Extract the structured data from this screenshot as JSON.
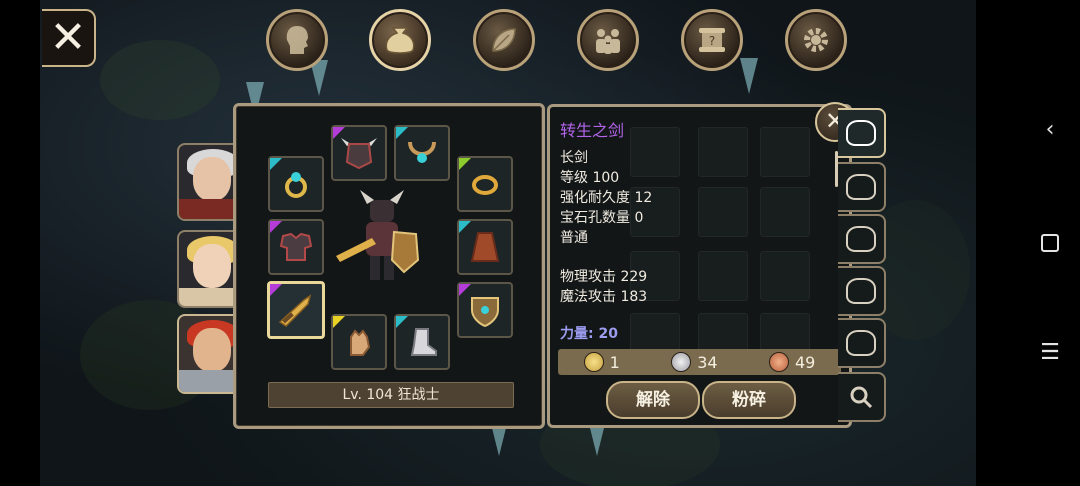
{
  "top_tabs": [
    {
      "name": "character",
      "icon": "head-silhouette-icon"
    },
    {
      "name": "inventory",
      "icon": "bag-icon",
      "active": true
    },
    {
      "name": "skills",
      "icon": "leaf-icon"
    },
    {
      "name": "party",
      "icon": "group-icon"
    },
    {
      "name": "quests",
      "icon": "scroll-icon"
    },
    {
      "name": "settings",
      "icon": "gear-icon"
    }
  ],
  "character": {
    "level_text": "Lv. 104 狂战士"
  },
  "item": {
    "name": "转生之剑",
    "type": "长剑",
    "level": "等级 100",
    "durability": "强化耐久度 12",
    "sockets": "宝石孔数量 0",
    "rarity": "普通",
    "phys_attack": "物理攻击 229",
    "mag_attack": "魔法攻击 183",
    "strength": "力量: 20"
  },
  "currency": {
    "gold": "1",
    "silver": "34",
    "copper": "49"
  },
  "actions": {
    "unequip": "解除",
    "shatter": "粉碎"
  },
  "colors": {
    "item_name": "#b264ea",
    "strength": "#9c9cf0",
    "frame": "#a99a80"
  }
}
